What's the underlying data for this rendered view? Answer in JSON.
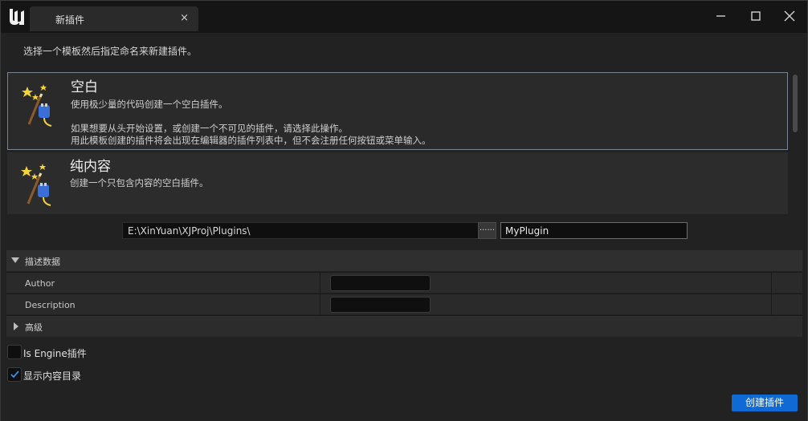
{
  "window": {
    "tab_title": "新插件",
    "tab_close": "×"
  },
  "instructions": "选择一个模板然后指定命名来新建插件。",
  "templates": [
    {
      "title": "空白",
      "lines": [
        "使用极少量的代码创建一个空白插件。",
        "",
        "如果想要从头开始设置，或创建一个不可见的插件，请选择此操作。",
        "用此模板创建的插件将会出现在编辑器的插件列表中，但不会注册任何按钮或菜单输入。"
      ],
      "selected": true
    },
    {
      "title": "纯内容",
      "lines": [
        "创建一个只包含内容的空白插件。"
      ],
      "selected": false
    }
  ],
  "path": {
    "value": "E:\\XinYuan\\XJProj\\Plugins\\",
    "browse_label": "......"
  },
  "plugin_name": {
    "value": "MyPlugin"
  },
  "details": {
    "section_label": "描述数据",
    "rows": [
      {
        "label": "Author",
        "value": ""
      },
      {
        "label": "Description",
        "value": ""
      }
    ],
    "advanced_label": "高级"
  },
  "options": {
    "is_engine": {
      "label": "Is Engine插件",
      "checked": false
    },
    "show_content": {
      "label": "显示内容目录",
      "checked": true
    }
  },
  "create_button": "创建插件",
  "colors": {
    "accent": "#0f6ad6",
    "focus_border": "#2f7ac9",
    "background": "#222222"
  }
}
